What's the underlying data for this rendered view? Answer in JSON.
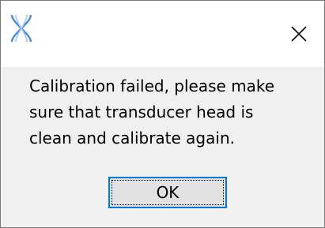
{
  "dialog": {
    "icon": "app-logo-icon",
    "close_icon": "close-icon",
    "message": "Calibration failed, please make\nsure that transducer head is\nclean and calibrate again.",
    "ok_label": "OK"
  },
  "colors": {
    "titlebar": "#ffffff",
    "body": "#f0f0f0",
    "button_border_focus": "#0078d7",
    "button_face": "#e1e1e1",
    "icon_blue": "#3b7fd4"
  }
}
